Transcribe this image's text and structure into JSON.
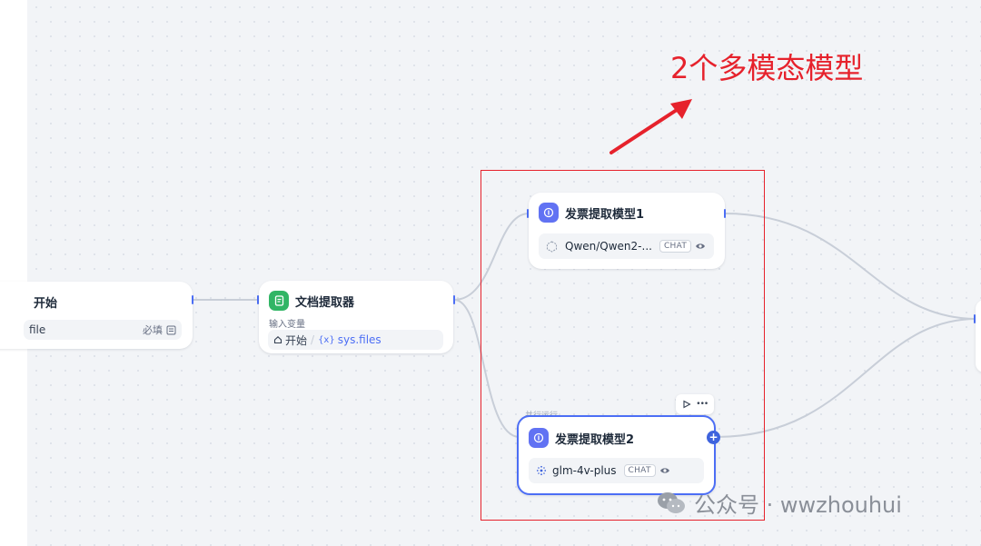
{
  "annotation": {
    "text": "2个多模态模型"
  },
  "start_node": {
    "title": "开始",
    "field": {
      "variable": "file",
      "required_label": "必填"
    }
  },
  "doc_extractor_node": {
    "title": "文档提取器",
    "input_label": "输入变量",
    "input": {
      "source": "开始",
      "variable_prefix": "{x}",
      "variable": "sys.files"
    }
  },
  "llm_node_1": {
    "title": "发票提取模型1",
    "model": "Qwen/Qwen2-...",
    "mode_badge": "CHAT"
  },
  "llm_node_2": {
    "title": "发票提取模型2",
    "caption": "并行运行",
    "model": "glm-4v-plus",
    "mode_badge": "CHAT"
  },
  "node_toolbar": {
    "more": "•••"
  },
  "watermark": {
    "text": "公众号 · wwzhouhui"
  },
  "colors": {
    "accent": "#4c6ef5",
    "annotation_red": "#e6222c",
    "llm_icon": "#6172f3",
    "doc_icon": "#31b565"
  }
}
